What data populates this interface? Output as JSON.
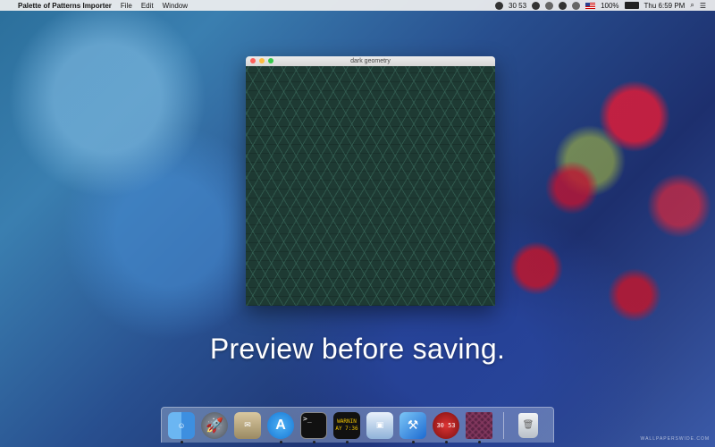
{
  "menubar": {
    "apple_glyph": "",
    "app_name": "Palette of Patterns Importer",
    "menus": [
      "File",
      "Edit",
      "Window"
    ],
    "status_numbers": "30 53",
    "battery": "100%",
    "clock": "Thu 6:59 PM",
    "search_glyph": "⌕",
    "list_glyph": "☰"
  },
  "window": {
    "title": "dark geometry"
  },
  "caption": "Preview before saving.",
  "dock": {
    "items": [
      {
        "name": "finder",
        "glyph": "☺"
      },
      {
        "name": "launchpad",
        "glyph": "🚀"
      },
      {
        "name": "mail",
        "glyph": "✉"
      },
      {
        "name": "app-store",
        "glyph": "A"
      },
      {
        "name": "terminal",
        "glyph": ">_"
      },
      {
        "name": "console",
        "line1": "WARNIN",
        "line2": "AY 7:36"
      },
      {
        "name": "preview",
        "glyph": "▣"
      },
      {
        "name": "xcode",
        "glyph": "⚒"
      },
      {
        "name": "clock",
        "glyph": "30 53"
      },
      {
        "name": "palette-of-patterns",
        "glyph": ""
      },
      {
        "name": "trash",
        "glyph": "🗑"
      }
    ]
  },
  "watermark": "WALLPAPERSWIDE.COM"
}
